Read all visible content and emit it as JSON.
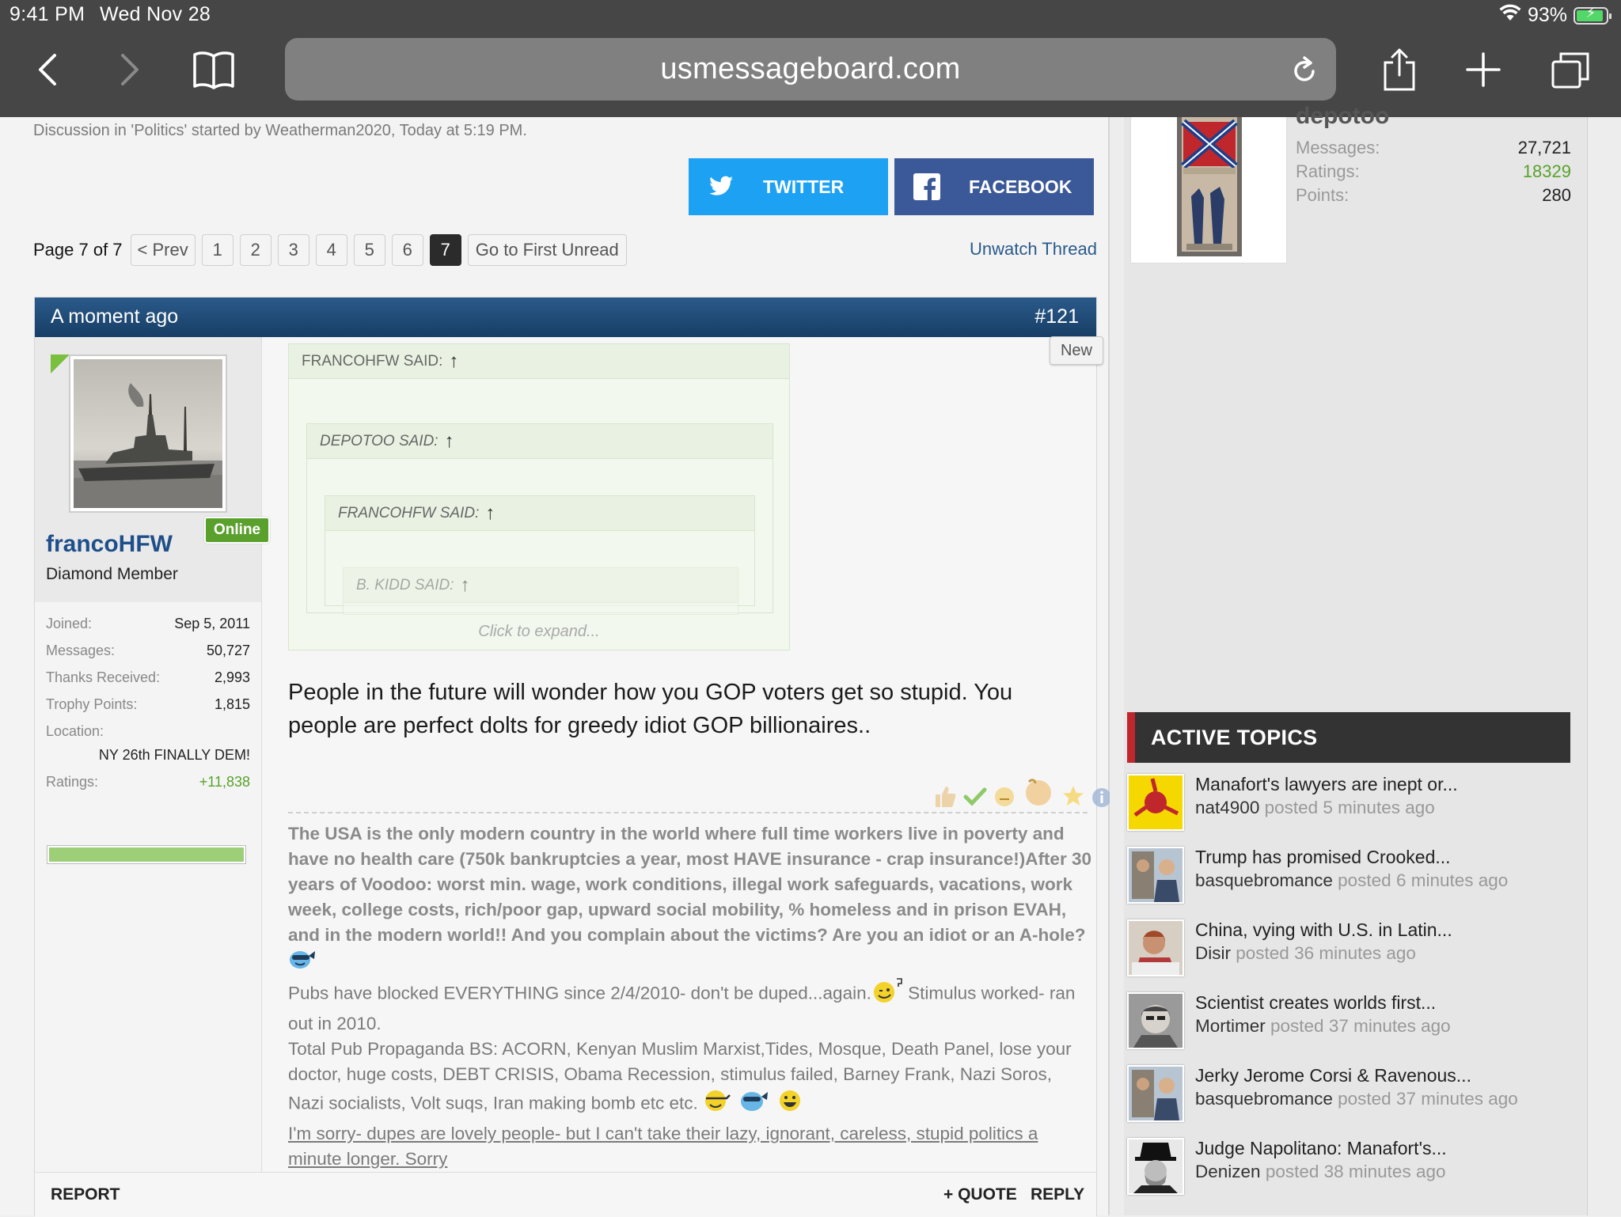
{
  "status_bar": {
    "time": "9:41 PM",
    "date": "Wed Nov 28",
    "battery": "93%",
    "battery_level": 0.93
  },
  "browser": {
    "url": "usmessageboard.com"
  },
  "thread": {
    "meta": "Discussion in 'Politics' started by Weatherman2020, Today at 5:19 PM.",
    "share": {
      "twitter": "TWITTER",
      "facebook": "FACEBOOK"
    },
    "pagination": {
      "label": "Page 7 of 7",
      "prev": "< Prev",
      "pages": [
        "1",
        "2",
        "3",
        "4",
        "5",
        "6",
        "7"
      ],
      "current": "7",
      "first_unread": "Go to First Unread"
    },
    "unwatch": "Unwatch Thread"
  },
  "post": {
    "time": "A moment ago",
    "number": "#121",
    "new_tag": "New",
    "user": {
      "name": "francoHFW",
      "title": "Diamond Member",
      "online": "Online",
      "stats": [
        {
          "label": "Joined:",
          "value": "Sep 5, 2011"
        },
        {
          "label": "Messages:",
          "value": "50,727"
        },
        {
          "label": "Thanks Received:",
          "value": "2,993"
        },
        {
          "label": "Trophy Points:",
          "value": "1,815"
        }
      ],
      "location_label": "Location:",
      "location": "NY 26th FINALLY DEM!",
      "ratings_label": "Ratings:",
      "ratings": "+11,838",
      "rating_level": 1.0
    },
    "quotes": [
      "FRANCOHFW SAID:",
      "DEPOTOO SAID:",
      "FRANCOHFW SAID:",
      "B. KIDD SAID:"
    ],
    "click_to_expand": "Click to expand...",
    "message": "People in the future will wonder how you GOP voters get so stupid. You people are perfect dolts for greedy idiot GOP billionaires..",
    "signature": {
      "bold": "The USA is the only modern country in the world where full time workers live in poverty and have no health care (750k bankruptcies a year, most HAVE insurance - crap insurance!)After 30 years of Voodoo: worst min. wage, work conditions, illegal work safeguards, vacations, work week, college costs, rich/poor gap, upward social mobility, % homeless and in prison EVAH, and in the modern world!! And you complain about the victims? Are you an idiot or an A-hole?",
      "line2a": "Pubs have blocked EVERYTHING since 2/4/2010- don't be duped...again.",
      "line2b": "Stimulus worked- ran out in 2010.",
      "line3": "Total Pub Propaganda BS: ACORN, Kenyan Muslim Marxist,Tides, Mosque, Death Panel, lose your doctor, huge costs, DEBT CRISIS, Obama Recession, stimulus failed, Barney Frank, Nazi Soros, Nazi socialists, Volt suqs, Iran making bomb etc etc.",
      "link": "I'm sorry- dupes are lovely people- but I can't take their lazy, ignorant, careless, stupid politics a minute longer. Sorry"
    },
    "actions": {
      "report": "REPORT",
      "quote": "+ QUOTE",
      "reply": "REPLY"
    }
  },
  "sidebar": {
    "user": {
      "name": "depotoo",
      "stats": [
        {
          "label": "Messages:",
          "value": "27,721"
        },
        {
          "label": "Ratings:",
          "value": "18329"
        },
        {
          "label": "Points:",
          "value": "280"
        }
      ]
    },
    "active_topics_title": "ACTIVE TOPICS",
    "topics": [
      {
        "title": "Manafort's lawyers are inept or...",
        "user": "nat4900",
        "posted": "posted 5 minutes ago"
      },
      {
        "title": "Trump has promised Crooked...",
        "user": "basquebromance",
        "posted": "posted 6 minutes ago"
      },
      {
        "title": "China, vying with U.S. in Latin...",
        "user": "Disir",
        "posted": "posted 36 minutes ago"
      },
      {
        "title": "Scientist creates worlds first...",
        "user": "Mortimer",
        "posted": "posted 37 minutes ago"
      },
      {
        "title": "Jerky Jerome Corsi & Ravenous...",
        "user": "basquebromance",
        "posted": "posted 37 minutes ago"
      },
      {
        "title": "Judge Napolitano: Manafort's...",
        "user": "Denizen",
        "posted": "posted 38 minutes ago"
      }
    ]
  },
  "colors": {
    "accent": "#2a5a8a",
    "twitter": "#1da1f2",
    "facebook": "#3b5998",
    "online": "#5aa02c",
    "topics_accent": "#c0272d"
  }
}
